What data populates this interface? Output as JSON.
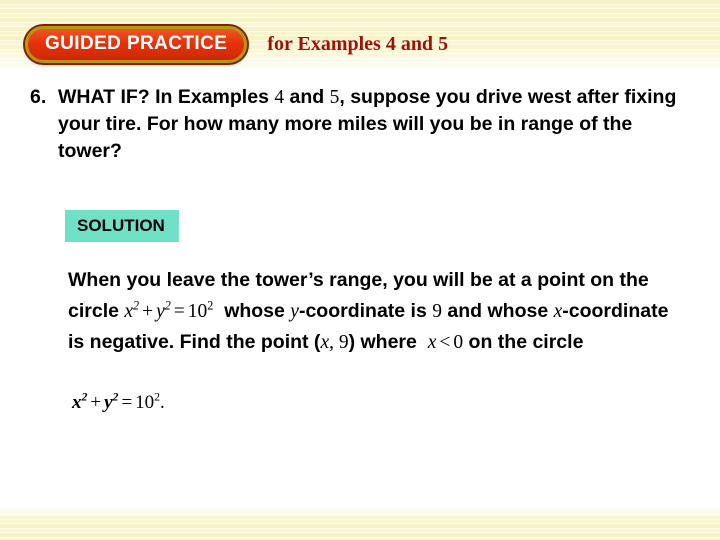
{
  "slide": {
    "background_color": "#ffffff",
    "stripe_color": "#f7f3c8"
  },
  "header": {
    "badge_label": "GUIDED PRACTICE",
    "badge_fill_color": "#e8380d",
    "badge_border_color": "#b8960f",
    "subtitle_prefix": "for Examples",
    "subtitle_example_a": "4",
    "subtitle_conjunction": "and",
    "subtitle_example_b": "5",
    "subtitle_color": "#9e1008"
  },
  "question": {
    "number": "6.",
    "part1": "WHAT IF? In Examples",
    "example_a": "4",
    "conjunction": "and",
    "example_b": "5",
    "part2": ", suppose you drive west after fixing your tire. For how many more miles will you be in range of the tower?"
  },
  "solution": {
    "label": "SOLUTION",
    "label_background_color": "#70e0c6",
    "line1": "When you leave the tower’s range, you will be at a point on the circle",
    "eq_x": "x",
    "eq_exp_x": "2",
    "eq_plus": "+",
    "eq_y": "y",
    "eq_exp_y": "2",
    "eq_equals": "=",
    "eq_ten": "10",
    "eq_exp_ten": "2",
    "line2": "whose",
    "coord_var_y": "y",
    "line3": "-coordinate is",
    "value_nine": "9",
    "line4": "and whose",
    "coord_var_x": "x",
    "line5": "-coordinate is negative. Find the point (",
    "point_var_x": "x",
    "point_comma": ", ",
    "point_nine": "9",
    "line6": ") where",
    "ineq_x": "x",
    "ineq_lt": "<",
    "ineq_zero": "0",
    "line7": "on the circle",
    "final_equation": {
      "x": "x",
      "x_exp": "2",
      "plus": "+",
      "y": "y",
      "y_exp": "2",
      "equals": "=",
      "ten": "10",
      "ten_exp": "2",
      "period": "."
    }
  }
}
